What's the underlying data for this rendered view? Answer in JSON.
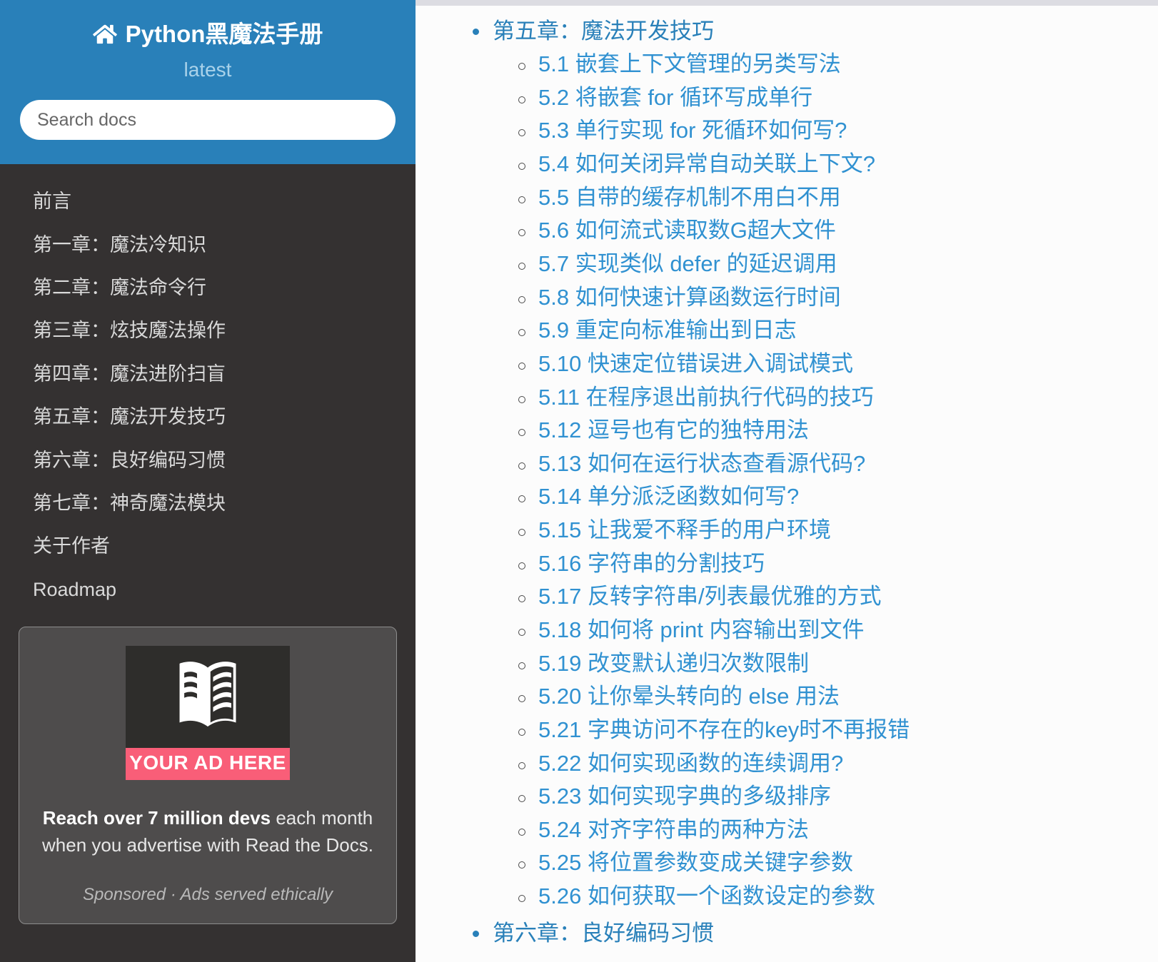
{
  "sidebar": {
    "brand": {
      "icon": "home-icon",
      "title": "Python黑魔法手册",
      "version": "latest"
    },
    "search": {
      "placeholder": "Search docs",
      "value": ""
    },
    "nav_items": [
      {
        "label": "前言"
      },
      {
        "label": "第一章：魔法冷知识"
      },
      {
        "label": "第二章：魔法命令行"
      },
      {
        "label": "第三章：炫技魔法操作"
      },
      {
        "label": "第四章：魔法进阶扫盲"
      },
      {
        "label": "第五章：魔法开发技巧"
      },
      {
        "label": "第六章：良好编码习惯"
      },
      {
        "label": "第七章：神奇魔法模块"
      },
      {
        "label": "关于作者"
      },
      {
        "label": "Roadmap"
      }
    ],
    "ad": {
      "logo_icon": "book-logo-icon",
      "banner_text": "YOUR AD HERE",
      "body_bold": "Reach over 7 million devs",
      "body_rest": " each month when you advertise with Read the Docs.",
      "note": "Sponsored · Ads served ethically"
    }
  },
  "content": {
    "chapters": [
      {
        "label": "第五章：魔法开发技巧",
        "sections": [
          {
            "label": "5.1 嵌套上下文管理的另类写法"
          },
          {
            "label": "5.2 将嵌套 for 循环写成单行"
          },
          {
            "label": "5.3 单行实现 for 死循环如何写?"
          },
          {
            "label": "5.4 如何关闭异常自动关联上下文?"
          },
          {
            "label": "5.5 自带的缓存机制不用白不用"
          },
          {
            "label": "5.6 如何流式读取数G超大文件"
          },
          {
            "label": "5.7 实现类似 defer 的延迟调用"
          },
          {
            "label": "5.8 如何快速计算函数运行时间"
          },
          {
            "label": "5.9 重定向标准输出到日志"
          },
          {
            "label": "5.10 快速定位错误进入调试模式"
          },
          {
            "label": "5.11 在程序退出前执行代码的技巧"
          },
          {
            "label": "5.12 逗号也有它的独特用法"
          },
          {
            "label": "5.13 如何在运行状态查看源代码?"
          },
          {
            "label": "5.14 单分派泛函数如何写?"
          },
          {
            "label": "5.15 让我爱不释手的用户环境"
          },
          {
            "label": "5.16 字符串的分割技巧"
          },
          {
            "label": "5.17 反转字符串/列表最优雅的方式"
          },
          {
            "label": "5.18 如何将 print 内容输出到文件"
          },
          {
            "label": "5.19 改变默认递归次数限制"
          },
          {
            "label": "5.20 让你晕头转向的 else 用法"
          },
          {
            "label": "5.21 字典访问不存在的key时不再报错"
          },
          {
            "label": "5.22 如何实现函数的连续调用?"
          },
          {
            "label": "5.23 如何实现字典的多级排序"
          },
          {
            "label": "5.24 对齐字符串的两种方法"
          },
          {
            "label": "5.25 将位置参数变成关键字参数"
          },
          {
            "label": "5.26 如何获取一个函数设定的参数"
          }
        ]
      },
      {
        "label": "第六章：良好编码习惯",
        "sections": []
      }
    ]
  },
  "colors": {
    "header_blue": "#2980b9",
    "sidebar_bg": "#343131",
    "link_blue": "#3091d1",
    "ad_pink": "#f95e78",
    "content_bg": "#fcfcfc",
    "top_strip": "#dcdce2"
  }
}
